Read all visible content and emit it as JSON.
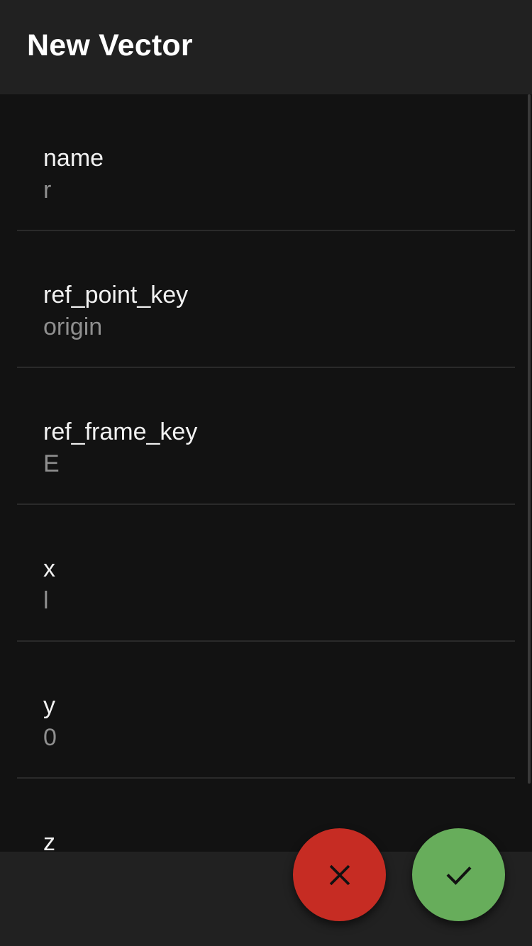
{
  "app_bar": {
    "title": "New Vector"
  },
  "fields": [
    {
      "label": "name",
      "value": "r"
    },
    {
      "label": "ref_point_key",
      "value": "origin"
    },
    {
      "label": "ref_frame_key",
      "value": "E"
    },
    {
      "label": "x",
      "value": "l"
    },
    {
      "label": "y",
      "value": "0"
    },
    {
      "label": "z",
      "value": ""
    }
  ],
  "actions": {
    "cancel_icon": "close-icon",
    "confirm_icon": "check-icon",
    "cancel_color": "#c62c23",
    "confirm_color": "#67ad5b"
  },
  "colors": {
    "background": "#121212",
    "app_bar": "#212121",
    "label_text": "#f2f2f2",
    "value_text": "#8f8f8f",
    "divider": "#2a2a2a"
  }
}
